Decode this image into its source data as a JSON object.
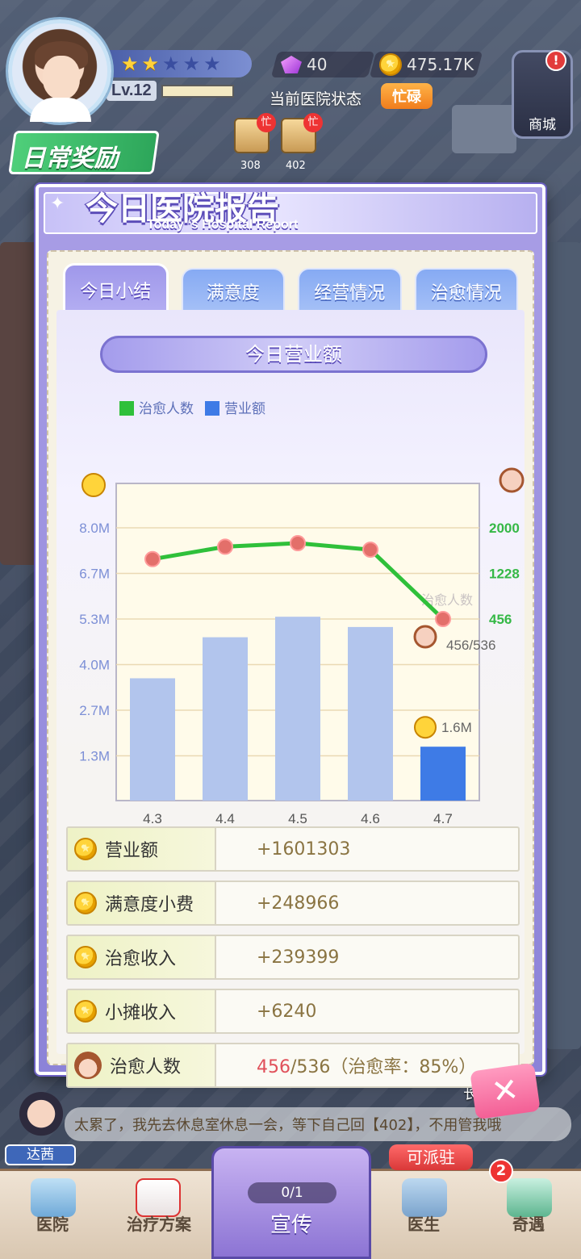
{
  "hud": {
    "level": "Lv.12",
    "stars_filled": 2,
    "stars_total": 5,
    "level_progress": 0,
    "gems": "40",
    "coins": "475.17K",
    "status_label": "当前医院状态",
    "status_value": "忙碌",
    "busy_badge": "忙",
    "room1_number": "308",
    "room2_number": "402",
    "daily_reward": "日常奖励",
    "shop_label": "商城"
  },
  "report": {
    "title_cn": "今日医院报告",
    "title_en": "Today ‘s Hospital Report",
    "tabs": [
      "今日小结",
      "满意度",
      "经营情况",
      "治愈情况"
    ],
    "active_tab": 0,
    "section_title": "今日营业额"
  },
  "chart_data": {
    "type": "bar+line",
    "legend": [
      "治愈人数",
      "营业额"
    ],
    "categories": [
      "4.3",
      "4.4",
      "4.5",
      "4.6",
      "4.7"
    ],
    "left_axis_ticks": [
      "8.0M",
      "6.7M",
      "5.3M",
      "4.0M",
      "2.7M",
      "1.3M"
    ],
    "right_axis_ticks": [
      "2000",
      "1228",
      "456"
    ],
    "right_axis_title": "治愈人数",
    "bar_series": {
      "name": "营业额",
      "values": [
        3.6,
        4.8,
        5.4,
        5.1,
        1.6
      ],
      "unit": "M"
    },
    "line_series": {
      "name": "治愈人数",
      "values": [
        1470,
        1680,
        1740,
        1630,
        456
      ]
    },
    "annotations": {
      "last_line_label": "456/536",
      "last_bar_label": "1.6M"
    },
    "colors": {
      "line": "#2fc03a",
      "bar": "#b2c5ed",
      "bar_highlight": "#3e7be6",
      "marker": "#e36f6a",
      "left_tick": "#7c8fd6",
      "right_tick": "#35b846"
    }
  },
  "summary_rows": [
    {
      "label": "营业额",
      "value": "+1601303"
    },
    {
      "label": "满意度小费",
      "value": "+248966"
    },
    {
      "label": "治愈收入",
      "value": "+239399"
    },
    {
      "label": "小摊收入",
      "value": "+6240"
    }
  ],
  "cure_row": {
    "label": "治愈人数",
    "cured": "456",
    "rest": "/536（治愈率：85%）"
  },
  "dialog": {
    "speaker": "达茜",
    "text": "太累了，我先去休息室休息一会，等下自己回【402】，不用管我哦",
    "right_hint": "长    加速"
  },
  "nav": {
    "items": [
      "医院",
      "治疗方案",
      "医生",
      "奇遇"
    ],
    "promo_count": "0/1",
    "promo_label": "宣传",
    "dispatch": "可派驻",
    "encounter_badge": "2"
  }
}
